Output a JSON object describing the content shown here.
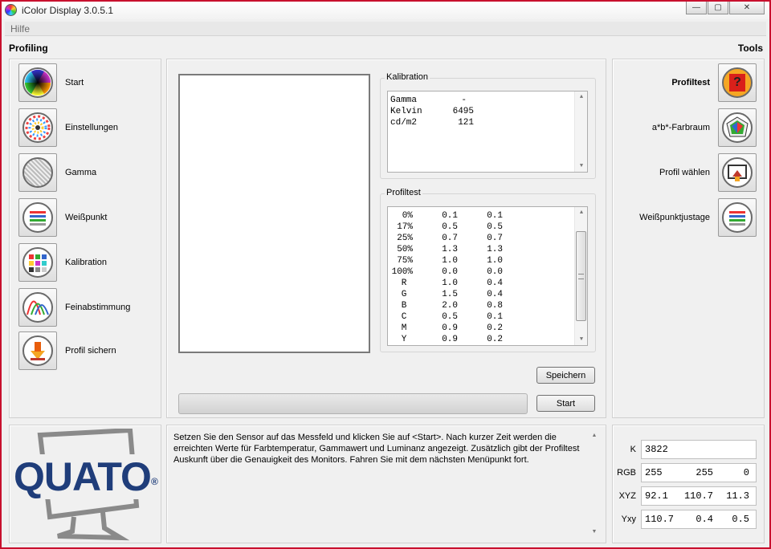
{
  "window": {
    "title": "iColor Display 3.0.5.1",
    "controls": {
      "minimize": "—",
      "maximize": "▢",
      "close": "✕"
    }
  },
  "menu": {
    "help": "Hilfe"
  },
  "profiling": {
    "title": "Profiling",
    "items": [
      {
        "label": "Start",
        "icon": "color-wheel-icon"
      },
      {
        "label": "Einstellungen",
        "icon": "settings-wheel-icon"
      },
      {
        "label": "Gamma",
        "icon": "gamma-pattern-icon"
      },
      {
        "label": "Weißpunkt",
        "icon": "white-point-icon"
      },
      {
        "label": "Kalibration",
        "icon": "calibration-grid-icon"
      },
      {
        "label": "Feinabstimmung",
        "icon": "curves-icon"
      },
      {
        "label": "Profil sichern",
        "icon": "save-profile-icon"
      }
    ]
  },
  "tools": {
    "title": "Tools",
    "items": [
      {
        "label": "Profiltest",
        "icon": "question-icon"
      },
      {
        "label": "a*b*-Farbraum",
        "icon": "gamut-icon"
      },
      {
        "label": "Profil wählen",
        "icon": "choose-profile-icon"
      },
      {
        "label": "Weißpunktjustage",
        "icon": "white-point-adjust-icon"
      }
    ]
  },
  "kalibration": {
    "title": "Kalibration",
    "rows": [
      {
        "key": "Gamma",
        "value": "-"
      },
      {
        "key": "Kelvin",
        "value": "6495"
      },
      {
        "key": "cd/m2",
        "value": "121"
      }
    ]
  },
  "profiltest": {
    "title": "Profiltest",
    "rows": [
      [
        "0%",
        "0.1",
        "0.1"
      ],
      [
        "17%",
        "0.5",
        "0.5"
      ],
      [
        "25%",
        "0.7",
        "0.7"
      ],
      [
        "50%",
        "1.3",
        "1.3"
      ],
      [
        "75%",
        "1.0",
        "1.0"
      ],
      [
        "100%",
        "0.0",
        "0.0"
      ],
      [
        "R",
        "1.0",
        "0.4"
      ],
      [
        "G",
        "1.5",
        "0.4"
      ],
      [
        "B",
        "2.0",
        "0.8"
      ],
      [
        "C",
        "0.5",
        "0.1"
      ],
      [
        "M",
        "0.9",
        "0.2"
      ],
      [
        "Y",
        "0.9",
        "0.2"
      ]
    ]
  },
  "buttons": {
    "save": "Speichern",
    "start": "Start"
  },
  "info": {
    "text": "Setzen Sie den Sensor auf das Messfeld und klicken Sie auf <Start>. Nach kurzer Zeit werden die erreichten Werte für Farbtemperatur, Gammawert und Luminanz angezeigt. Zusätzlich gibt der Profiltest Auskunft über die Genauigkeit des Monitors. Fahren Sie mit dem nächsten Menüpunkt fort."
  },
  "logo": {
    "text": "QUATO",
    "mark": "®"
  },
  "measurements": [
    {
      "label": "K",
      "values": [
        "3822"
      ]
    },
    {
      "label": "RGB",
      "values": [
        "255",
        "255",
        "0"
      ]
    },
    {
      "label": "XYZ",
      "values": [
        "92.1",
        "110.7",
        "11.3"
      ]
    },
    {
      "label": "Yxy",
      "values": [
        "110.7",
        "0.4",
        "0.5"
      ]
    }
  ],
  "colors": {
    "window_border": "#c8102e",
    "logo_blue": "#1f3d7a"
  }
}
